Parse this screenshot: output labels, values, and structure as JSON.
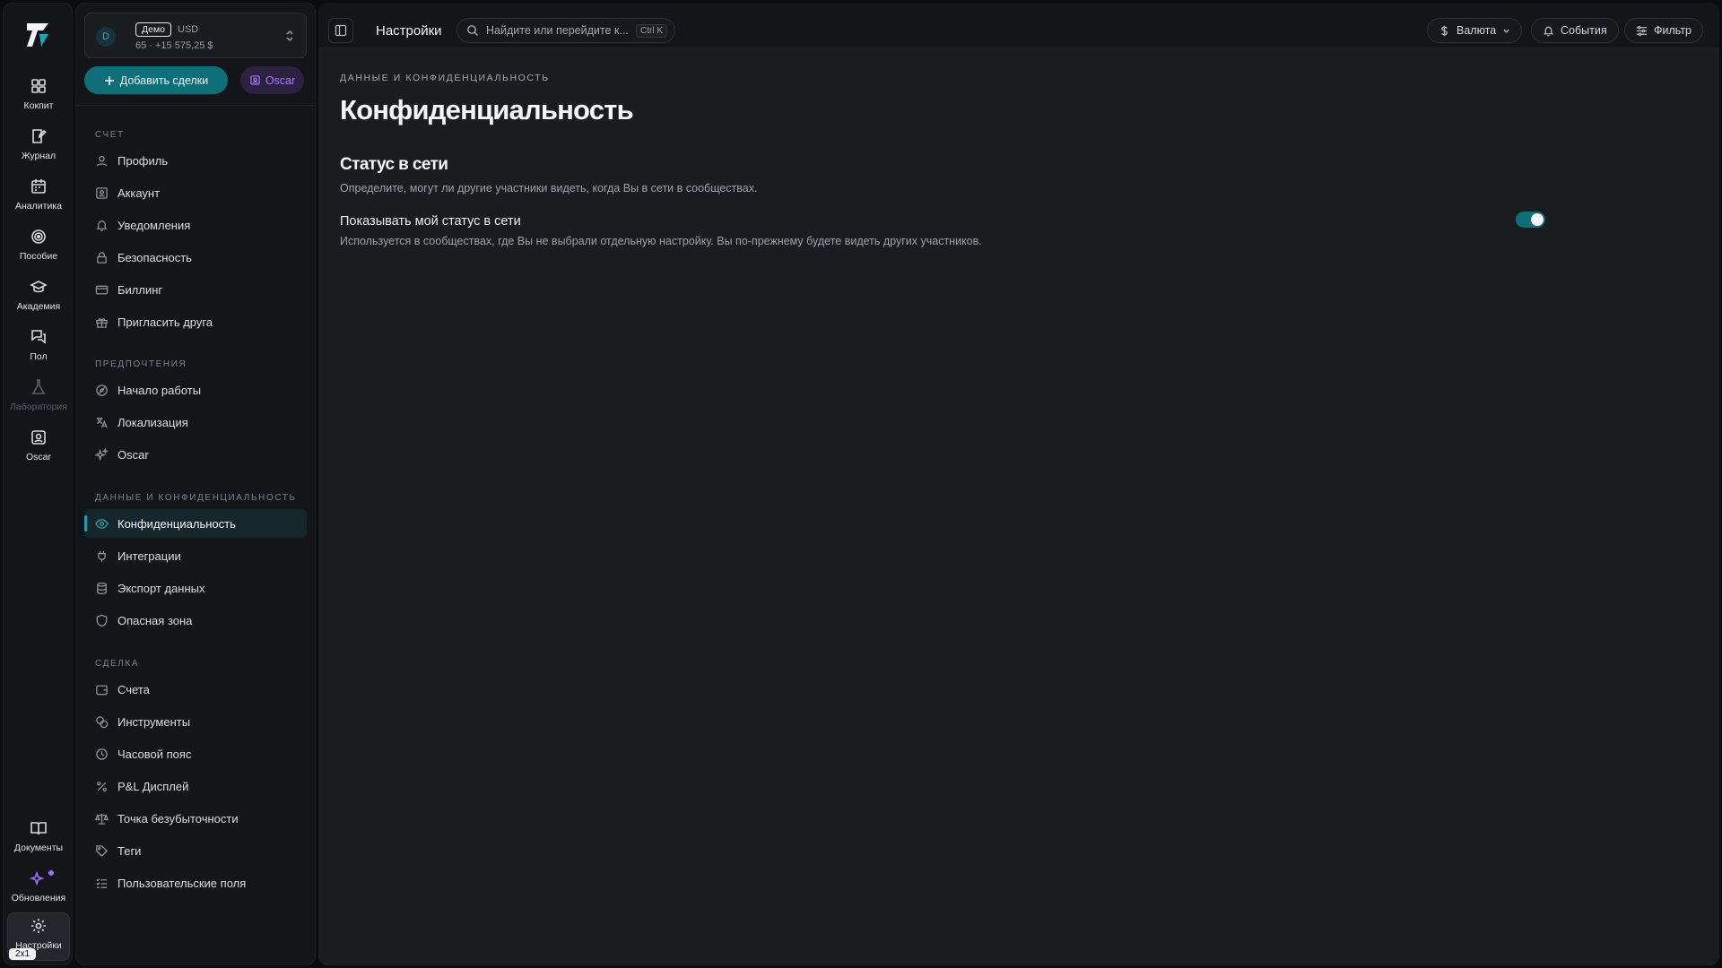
{
  "rail": {
    "items": [
      {
        "label": "Кокпит",
        "icon": "dashboard-icon"
      },
      {
        "label": "Журнал",
        "icon": "journal-icon"
      },
      {
        "label": "Аналитика",
        "icon": "analytics-icon"
      },
      {
        "label": "Пособие",
        "icon": "target-icon"
      },
      {
        "label": "Академия",
        "icon": "graduation-cap-icon"
      },
      {
        "label": "Пол",
        "icon": "chat-icon"
      },
      {
        "label": "Лаборатория",
        "icon": "flask-icon"
      },
      {
        "label": "Oscar",
        "icon": "oscar-icon"
      }
    ],
    "bottom": [
      {
        "label": "Документы",
        "icon": "book-icon"
      },
      {
        "label": "Обновления",
        "icon": "sparkle-icon"
      },
      {
        "label": "Настройки",
        "icon": "gear-icon"
      }
    ],
    "badge": "2x1"
  },
  "account": {
    "avatar": "D",
    "tag": "Демо",
    "currency": "USD",
    "subtitle": "65 · +15 575,25 $"
  },
  "actions": {
    "add_trade": "Добавить сделки",
    "oscar": "Oscar"
  },
  "nav": {
    "sections": [
      {
        "title": "Счет",
        "items": [
          "Профиль",
          "Аккаунт",
          "Уведомления",
          "Безопасность",
          "Биллинг",
          "Пригласить друга"
        ]
      },
      {
        "title": "Предпочтения",
        "items": [
          "Начало работы",
          "Локализация",
          "Oscar"
        ]
      },
      {
        "title": "Данные и конфиденциальность",
        "items": [
          "Конфиденциальность",
          "Интеграции",
          "Экспорт данных",
          "Опасная зона"
        ]
      },
      {
        "title": "Сделка",
        "items": [
          "Счета",
          "Инструменты",
          "Часовой пояс",
          "P&L Дисплей",
          "Точка безубыточности",
          "Теги",
          "Пользовательские поля"
        ]
      }
    ],
    "active": "Конфиденциальность"
  },
  "topbar": {
    "title": "Настройки",
    "search_placeholder": "Найдите или перейдите к...",
    "shortcut": "Ctrl K",
    "currency_btn": "Валюта",
    "events_btn": "События",
    "filter_btn": "Фильтр"
  },
  "page": {
    "eyebrow": "Данные и конфиденциальность",
    "title": "Конфиденциальность",
    "section_title": "Статус в сети",
    "section_desc": "Определите, могут ли другие участники видеть, когда Вы в сети в сообществах.",
    "option_label": "Показывать мой статус в сети",
    "option_desc": "Используется в сообществах, где Вы не выбрали отдельную настройку. Вы по-прежнему будете видеть других участников.",
    "option_enabled": true
  },
  "colors": {
    "accent": "#0f6f78",
    "oscar": "#a57bff",
    "bg": "#1b1c20"
  }
}
